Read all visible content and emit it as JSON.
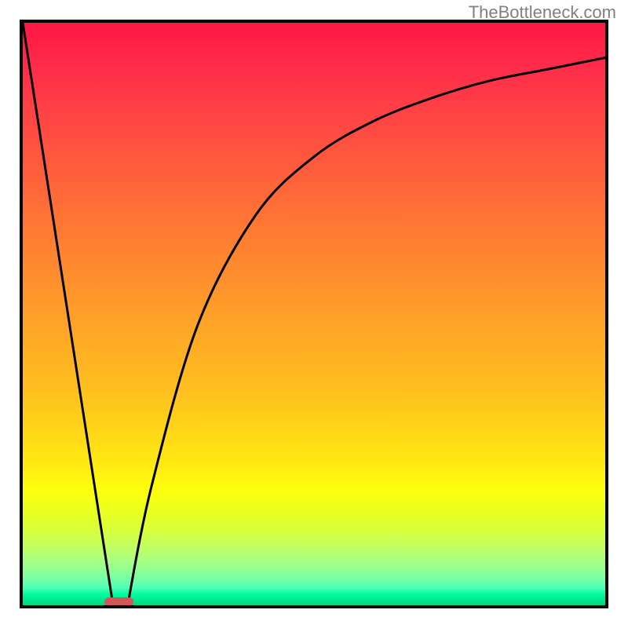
{
  "watermark": "TheBottleneck.com",
  "chart_data": {
    "type": "line",
    "title": "",
    "xlabel": "",
    "ylabel": "",
    "xlim": [
      0,
      100
    ],
    "ylim": [
      0,
      100
    ],
    "series": [
      {
        "name": "left-line",
        "x": [
          0,
          15.5
        ],
        "values": [
          100,
          0
        ]
      },
      {
        "name": "right-curve",
        "x": [
          18,
          22,
          30,
          40,
          50,
          60,
          70,
          80,
          90,
          100
        ],
        "values": [
          0,
          20,
          48,
          67,
          77,
          83,
          87,
          90,
          92,
          94
        ]
      }
    ],
    "background_gradient": {
      "stops": [
        "#ff1744",
        "#ff8530",
        "#ffea12",
        "#00e890"
      ],
      "positions": [
        0,
        40,
        76,
        100
      ]
    },
    "marker": {
      "x": 16.5,
      "y": 0,
      "width_pct": 5,
      "color": "#d05858"
    }
  }
}
